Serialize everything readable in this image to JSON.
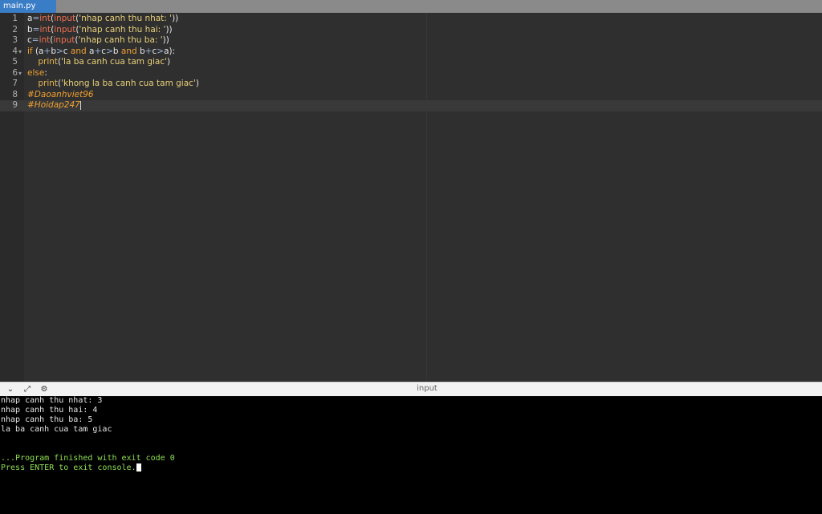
{
  "tab": {
    "label": "main.py"
  },
  "editor": {
    "lines": [
      {
        "num": "1",
        "parts": [
          [
            "",
            "a"
          ],
          [
            "op",
            "="
          ],
          [
            "fn",
            "int"
          ],
          [
            "",
            "("
          ],
          [
            "fn",
            "input"
          ],
          [
            "",
            "("
          ],
          [
            "str",
            "'nhap canh thu nhat: '"
          ],
          [
            "",
            "))"
          ]
        ]
      },
      {
        "num": "2",
        "parts": [
          [
            "",
            "b"
          ],
          [
            "op",
            "="
          ],
          [
            "fn",
            "int"
          ],
          [
            "",
            "("
          ],
          [
            "fn",
            "input"
          ],
          [
            "",
            "("
          ],
          [
            "str",
            "'nhap canh thu hai: '"
          ],
          [
            "",
            "))"
          ]
        ]
      },
      {
        "num": "3",
        "parts": [
          [
            "",
            "c"
          ],
          [
            "op",
            "="
          ],
          [
            "fn",
            "int"
          ],
          [
            "",
            "("
          ],
          [
            "fn",
            "input"
          ],
          [
            "",
            "("
          ],
          [
            "str",
            "'nhap canh thu ba: '"
          ],
          [
            "",
            "))"
          ]
        ]
      },
      {
        "num": "4",
        "fold": true,
        "parts": [
          [
            "kw",
            "if"
          ],
          [
            "",
            " (a"
          ],
          [
            "op",
            "+"
          ],
          [
            "",
            "b"
          ],
          [
            "op",
            ">"
          ],
          [
            "",
            "c "
          ],
          [
            "kw",
            "and"
          ],
          [
            "",
            " a"
          ],
          [
            "op",
            "+"
          ],
          [
            "",
            "c"
          ],
          [
            "op",
            ">"
          ],
          [
            "",
            "b "
          ],
          [
            "kw",
            "and"
          ],
          [
            "",
            " b"
          ],
          [
            "op",
            "+"
          ],
          [
            "",
            "c"
          ],
          [
            "op",
            ">"
          ],
          [
            "",
            "a):"
          ]
        ]
      },
      {
        "num": "5",
        "parts": [
          [
            "",
            "    "
          ],
          [
            "bi",
            "print"
          ],
          [
            "",
            "("
          ],
          [
            "str",
            "'la ba canh cua tam giac'"
          ],
          [
            "",
            ")"
          ]
        ]
      },
      {
        "num": "6",
        "fold": true,
        "parts": [
          [
            "kw",
            "else"
          ],
          [
            "",
            ":"
          ]
        ]
      },
      {
        "num": "7",
        "parts": [
          [
            "",
            "    "
          ],
          [
            "bi",
            "print"
          ],
          [
            "",
            "("
          ],
          [
            "str",
            "'khong la ba canh cua tam giac'"
          ],
          [
            "",
            ")"
          ]
        ]
      },
      {
        "num": "8",
        "parts": [
          [
            "cm",
            "#Daoanhviet96"
          ]
        ]
      },
      {
        "num": "9",
        "active": true,
        "parts": [
          [
            "cm",
            "#Hoidap247"
          ]
        ]
      }
    ]
  },
  "panel": {
    "title": "input",
    "buttons": [
      "chevron-down-icon",
      "expand-icon",
      "settings-icon"
    ]
  },
  "console": {
    "lines": [
      {
        "text": "nhap canh thu nhat: 3",
        "style": ""
      },
      {
        "text": "nhap canh thu hai: 4",
        "style": ""
      },
      {
        "text": "nhap canh thu ba: 5",
        "style": ""
      },
      {
        "text": "la ba canh cua tam giac",
        "style": ""
      },
      {
        "text": "",
        "style": ""
      },
      {
        "text": "",
        "style": ""
      },
      {
        "text": "...Program finished with exit code 0",
        "style": "green"
      },
      {
        "text": "Press ENTER to exit console.",
        "style": "green",
        "cursor": true
      }
    ]
  },
  "colors": {
    "tab_active": "#3a7dc7",
    "editor_bg": "#2f2f2f",
    "console_bg": "#000000",
    "console_green": "#8ee052"
  }
}
